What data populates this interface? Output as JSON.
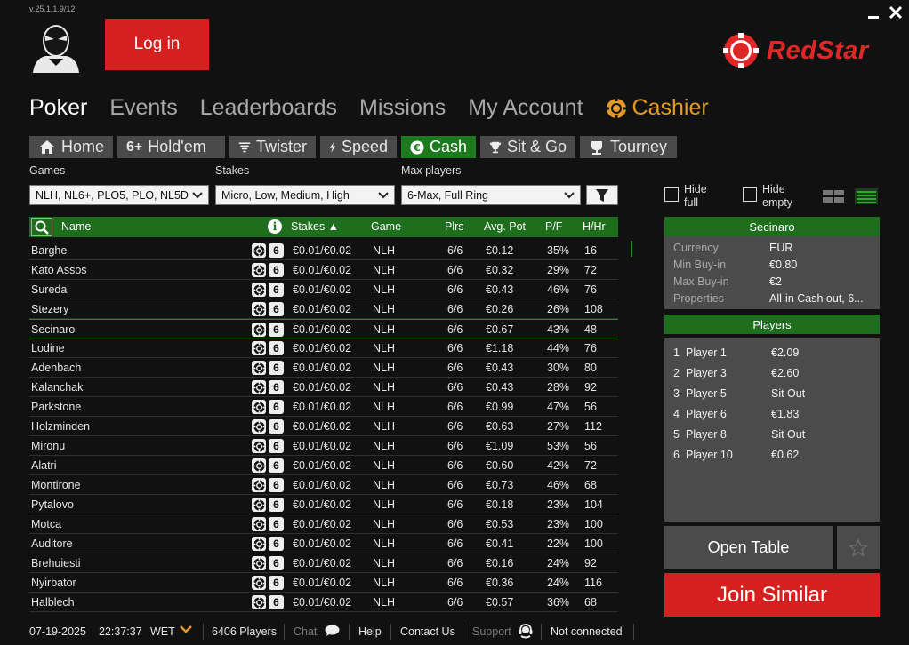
{
  "app": {
    "version": "v.25.1.1.9/12",
    "brand": "RedStar",
    "colors": {
      "accent_red": "#d62020",
      "accent_green": "#1e6e1e",
      "cashier_gold": "#e39a28"
    }
  },
  "window_controls": {
    "minimize_icon": "minimize-icon",
    "close_icon": "close-icon"
  },
  "header": {
    "login_label": "Log in"
  },
  "main_nav": [
    {
      "label": "Poker",
      "active": true
    },
    {
      "label": "Events"
    },
    {
      "label": "Leaderboards"
    },
    {
      "label": "Missions"
    },
    {
      "label": "My Account"
    },
    {
      "label": "Cashier",
      "icon": "chip-icon"
    }
  ],
  "sub_tabs": [
    {
      "label": "Home",
      "icon": "home-icon"
    },
    {
      "label": "Hold'em",
      "icon_text": "6+"
    },
    {
      "label": "Twister",
      "icon": "tornado-icon"
    },
    {
      "label": "Speed",
      "icon": "lightning-icon"
    },
    {
      "label": "Cash",
      "icon": "euro-icon",
      "active": true
    },
    {
      "label": "Sit & Go",
      "icon": "trophy-icon"
    },
    {
      "label": "Tourney",
      "icon": "cup-icon"
    }
  ],
  "filters": {
    "games": {
      "label": "Games",
      "value": "NLH, NL6+, PLO5, PLO, NL5D"
    },
    "stakes": {
      "label": "Stakes",
      "value": "Micro, Low, Medium, High"
    },
    "max_players": {
      "label": "Max players",
      "value": "6-Max, Full Ring"
    },
    "hide_full": {
      "line1": "Hide",
      "line2": "full"
    },
    "hide_empty": {
      "line1": "Hide",
      "line2": "empty"
    }
  },
  "table": {
    "columns": {
      "name": "Name",
      "stakes": "Stakes ▲",
      "game": "Game",
      "plrs": "Plrs",
      "avg_pot": "Avg. Pot",
      "pf": "P/F",
      "hhr": "H/Hr"
    },
    "badge_text": "6",
    "rows": [
      {
        "name": "Barghe",
        "stakes": "€0.01/€0.02",
        "game": "NLH",
        "plrs": "6/6",
        "avg_pot": "€0.12",
        "pf": "35%",
        "hhr": "16"
      },
      {
        "name": "Kato Assos",
        "stakes": "€0.01/€0.02",
        "game": "NLH",
        "plrs": "6/6",
        "avg_pot": "€0.32",
        "pf": "29%",
        "hhr": "72"
      },
      {
        "name": "Sureda",
        "stakes": "€0.01/€0.02",
        "game": "NLH",
        "plrs": "6/6",
        "avg_pot": "€0.43",
        "pf": "46%",
        "hhr": "76"
      },
      {
        "name": "Stezery",
        "stakes": "€0.01/€0.02",
        "game": "NLH",
        "plrs": "6/6",
        "avg_pot": "€0.26",
        "pf": "26%",
        "hhr": "108"
      },
      {
        "name": "Secinaro",
        "stakes": "€0.01/€0.02",
        "game": "NLH",
        "plrs": "6/6",
        "avg_pot": "€0.67",
        "pf": "43%",
        "hhr": "48",
        "selected": true
      },
      {
        "name": "Lodine",
        "stakes": "€0.01/€0.02",
        "game": "NLH",
        "plrs": "6/6",
        "avg_pot": "€1.18",
        "pf": "44%",
        "hhr": "76"
      },
      {
        "name": "Adenbach",
        "stakes": "€0.01/€0.02",
        "game": "NLH",
        "plrs": "6/6",
        "avg_pot": "€0.43",
        "pf": "30%",
        "hhr": "80"
      },
      {
        "name": "Kalanchak",
        "stakes": "€0.01/€0.02",
        "game": "NLH",
        "plrs": "6/6",
        "avg_pot": "€0.43",
        "pf": "28%",
        "hhr": "92"
      },
      {
        "name": "Parkstone",
        "stakes": "€0.01/€0.02",
        "game": "NLH",
        "plrs": "6/6",
        "avg_pot": "€0.99",
        "pf": "47%",
        "hhr": "56"
      },
      {
        "name": "Holzminden",
        "stakes": "€0.01/€0.02",
        "game": "NLH",
        "plrs": "6/6",
        "avg_pot": "€0.63",
        "pf": "27%",
        "hhr": "112"
      },
      {
        "name": "Mironu",
        "stakes": "€0.01/€0.02",
        "game": "NLH",
        "plrs": "6/6",
        "avg_pot": "€1.09",
        "pf": "53%",
        "hhr": "56"
      },
      {
        "name": "Alatri",
        "stakes": "€0.01/€0.02",
        "game": "NLH",
        "plrs": "6/6",
        "avg_pot": "€0.60",
        "pf": "42%",
        "hhr": "72"
      },
      {
        "name": "Montirone",
        "stakes": "€0.01/€0.02",
        "game": "NLH",
        "plrs": "6/6",
        "avg_pot": "€0.73",
        "pf": "46%",
        "hhr": "68"
      },
      {
        "name": "Pytalovo",
        "stakes": "€0.01/€0.02",
        "game": "NLH",
        "plrs": "6/6",
        "avg_pot": "€0.18",
        "pf": "23%",
        "hhr": "104"
      },
      {
        "name": "Motca",
        "stakes": "€0.01/€0.02",
        "game": "NLH",
        "plrs": "6/6",
        "avg_pot": "€0.53",
        "pf": "23%",
        "hhr": "100"
      },
      {
        "name": "Auditore",
        "stakes": "€0.01/€0.02",
        "game": "NLH",
        "plrs": "6/6",
        "avg_pot": "€0.41",
        "pf": "22%",
        "hhr": "100"
      },
      {
        "name": "Brehuiesti",
        "stakes": "€0.01/€0.02",
        "game": "NLH",
        "plrs": "6/6",
        "avg_pot": "€0.16",
        "pf": "24%",
        "hhr": "92"
      },
      {
        "name": "Nyirbator",
        "stakes": "€0.01/€0.02",
        "game": "NLH",
        "plrs": "6/6",
        "avg_pot": "€0.36",
        "pf": "24%",
        "hhr": "116"
      },
      {
        "name": "Halblech",
        "stakes": "€0.01/€0.02",
        "game": "NLH",
        "plrs": "6/6",
        "avg_pot": "€0.57",
        "pf": "36%",
        "hhr": "68"
      }
    ]
  },
  "details": {
    "title": "Secinaro",
    "rows": [
      {
        "k": "Currency",
        "v": "EUR"
      },
      {
        "k": "Min Buy-in",
        "v": "€0.80"
      },
      {
        "k": "Max Buy-in",
        "v": "€2"
      },
      {
        "k": "Properties",
        "v": "All-in Cash out, 6..."
      }
    ]
  },
  "players": {
    "title": "Players",
    "rows": [
      {
        "n": "1",
        "name": "Player 1",
        "val": "€2.09"
      },
      {
        "n": "2",
        "name": "Player 3",
        "val": "€2.60"
      },
      {
        "n": "3",
        "name": "Player 5",
        "val": "Sit Out"
      },
      {
        "n": "4",
        "name": "Player 6",
        "val": "€1.83"
      },
      {
        "n": "5",
        "name": "Player 8",
        "val": "Sit Out"
      },
      {
        "n": "6",
        "name": "Player 10",
        "val": "€0.62"
      }
    ]
  },
  "actions": {
    "open_table": "Open Table",
    "join_similar": "Join Similar"
  },
  "status": {
    "date": "07-19-2025",
    "time": "22:37:37",
    "tz": "WET",
    "players": "6406 Players",
    "chat": "Chat",
    "help": "Help",
    "contact": "Contact Us",
    "support": "Support",
    "connection": "Not connected"
  }
}
